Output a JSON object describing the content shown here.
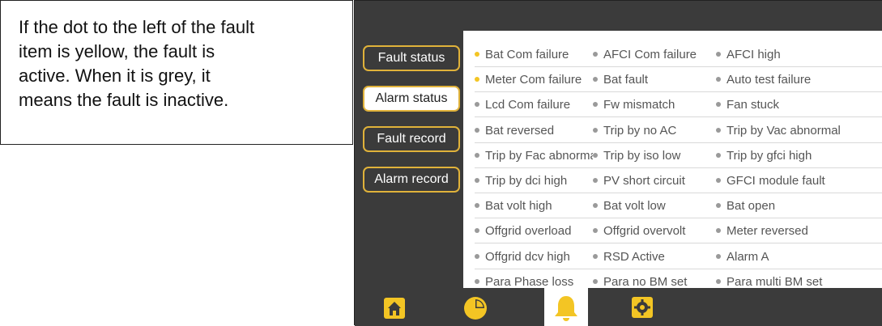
{
  "callout": {
    "lines": [
      "If the dot to the left of the fault",
      "item is yellow, the fault is",
      "active. When it is grey, it",
      "means the fault is inactive."
    ]
  },
  "tabs": [
    {
      "label": "Fault status",
      "active": false
    },
    {
      "label": "Alarm status",
      "active": true
    },
    {
      "label": "Fault record",
      "active": false
    },
    {
      "label": "Alarm record",
      "active": false
    }
  ],
  "faults": [
    [
      {
        "label": "Bat Com failure",
        "dot": "yellow"
      },
      {
        "label": "AFCI Com failure",
        "dot": "grey"
      },
      {
        "label": "AFCI high",
        "dot": "grey"
      }
    ],
    [
      {
        "label": "Meter Com failure",
        "dot": "yellow"
      },
      {
        "label": "Bat fault",
        "dot": "grey"
      },
      {
        "label": "Auto test failure",
        "dot": "grey"
      }
    ],
    [
      {
        "label": "Lcd Com failure",
        "dot": "grey"
      },
      {
        "label": "Fw mismatch",
        "dot": "grey"
      },
      {
        "label": "Fan stuck",
        "dot": "grey"
      }
    ],
    [
      {
        "label": "Bat reversed",
        "dot": "grey"
      },
      {
        "label": "Trip by no AC",
        "dot": "grey"
      },
      {
        "label": "Trip by Vac abnormal",
        "dot": "grey"
      }
    ],
    [
      {
        "label": "Trip by Fac abnormal",
        "dot": "grey"
      },
      {
        "label": "Trip by iso low",
        "dot": "grey"
      },
      {
        "label": "Trip by gfci high",
        "dot": "grey"
      }
    ],
    [
      {
        "label": "Trip by dci high",
        "dot": "grey"
      },
      {
        "label": "PV short circuit",
        "dot": "grey"
      },
      {
        "label": "GFCI module fault",
        "dot": "grey"
      }
    ],
    [
      {
        "label": "Bat volt high",
        "dot": "grey"
      },
      {
        "label": "Bat volt low",
        "dot": "grey"
      },
      {
        "label": "Bat open",
        "dot": "grey"
      }
    ],
    [
      {
        "label": "Offgrid overload",
        "dot": "grey"
      },
      {
        "label": "Offgrid overvolt",
        "dot": "grey"
      },
      {
        "label": "Meter reversed",
        "dot": "grey"
      }
    ],
    [
      {
        "label": "Offgrid dcv high",
        "dot": "grey"
      },
      {
        "label": "RSD Active",
        "dot": "grey"
      },
      {
        "label": "Alarm A",
        "dot": "grey"
      }
    ],
    [
      {
        "label": "Para Phase loss",
        "dot": "grey"
      },
      {
        "label": "Para no BM set",
        "dot": "grey"
      },
      {
        "label": "Para multi BM set",
        "dot": "grey"
      }
    ]
  ],
  "nav": [
    {
      "name": "home-icon",
      "active": false
    },
    {
      "name": "pie-chart-icon",
      "active": false
    },
    {
      "name": "bell-icon",
      "active": true
    },
    {
      "name": "gear-icon",
      "active": false
    }
  ],
  "colors": {
    "accent": "#e0b23a",
    "active_dot": "#f3c524",
    "inactive_dot": "#9a9a9a",
    "screen_bg": "#3b3b3b"
  }
}
